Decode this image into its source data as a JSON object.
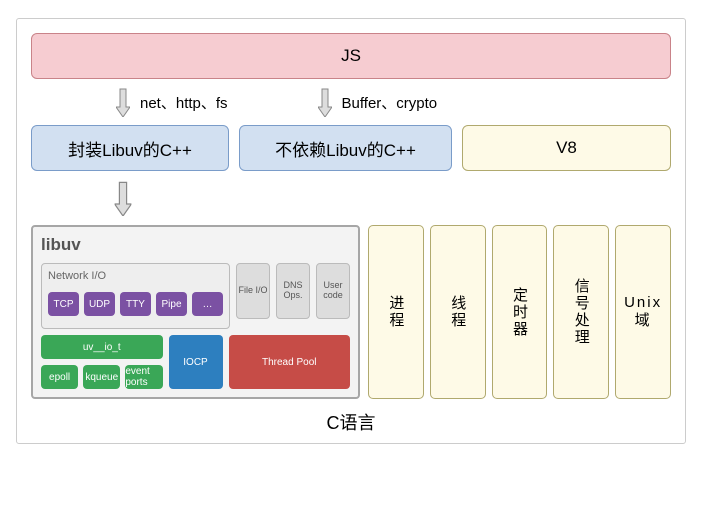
{
  "top": {
    "js": "JS"
  },
  "arrows": {
    "left_label": "net、http、fs",
    "right_label": "Buffer、crypto"
  },
  "middle": {
    "cpp_libuv": "封装Libuv的C++",
    "cpp_no_libuv": "不依赖Libuv的C++",
    "v8": "V8"
  },
  "libuv": {
    "title": "libuv",
    "network_io": {
      "title": "Network I/O",
      "top_row": [
        "TCP",
        "UDP",
        "TTY",
        "Pipe",
        "…"
      ],
      "uv_io": "uv__io_t",
      "bottom_row": [
        "epoll",
        "kqueue",
        "event ports"
      ]
    },
    "grey": [
      "File I/O",
      "DNS Ops.",
      "User code"
    ],
    "iocp": "IOCP",
    "thread_pool": "Thread Pool"
  },
  "side_cols": [
    "进程",
    "线程",
    "定时器",
    "信号处理",
    "Unix 域"
  ],
  "footer": "C语言"
}
